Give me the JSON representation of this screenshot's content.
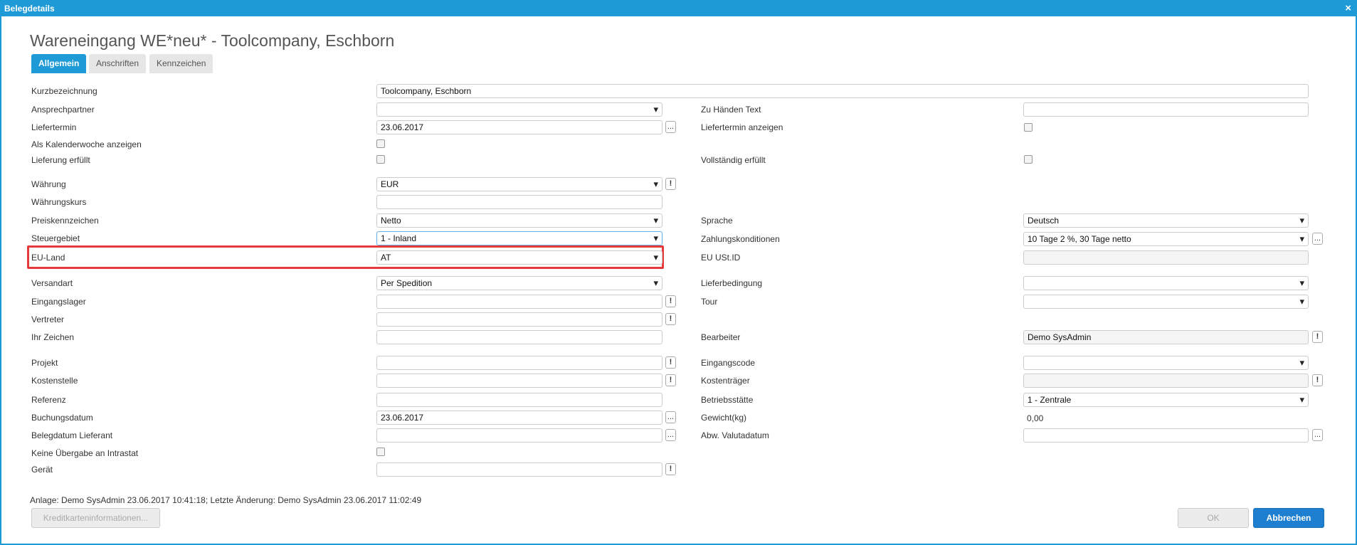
{
  "window": {
    "title": "Belegdetails",
    "close_glyph": "×"
  },
  "heading": "Wareneingang WE*neu* - Toolcompany, Eschborn",
  "tabs": [
    {
      "label": "Allgemein",
      "active": true
    },
    {
      "label": "Anschriften",
      "active": false
    },
    {
      "label": "Kennzeichen",
      "active": false
    }
  ],
  "left": {
    "kurzbezeichnung": {
      "label": "Kurzbezeichnung",
      "value": "Toolcompany, Eschborn"
    },
    "ansprechpartner": {
      "label": "Ansprechpartner",
      "value": ""
    },
    "liefertermin": {
      "label": "Liefertermin",
      "value": "23.06.2017"
    },
    "kalenderwoche": {
      "label": "Als Kalenderwoche anzeigen"
    },
    "lieferung_erfuellt": {
      "label": "Lieferung erfüllt"
    },
    "waehrung": {
      "label": "Währung",
      "value": "EUR"
    },
    "waehrungskurs": {
      "label": "Währungskurs",
      "value": ""
    },
    "preiskennzeichen": {
      "label": "Preiskennzeichen",
      "value": "Netto"
    },
    "steuergebiet": {
      "label": "Steuergebiet",
      "value": "1 - Inland"
    },
    "eu_land": {
      "label": "EU-Land",
      "value": "AT"
    },
    "versandart": {
      "label": "Versandart",
      "value": "Per Spedition"
    },
    "eingangslager": {
      "label": "Eingangslager",
      "value": ""
    },
    "vertreter": {
      "label": "Vertreter",
      "value": ""
    },
    "ihr_zeichen": {
      "label": "Ihr Zeichen",
      "value": ""
    },
    "projekt": {
      "label": "Projekt",
      "value": ""
    },
    "kostenstelle": {
      "label": "Kostenstelle",
      "value": ""
    },
    "referenz": {
      "label": "Referenz",
      "value": ""
    },
    "buchungsdatum": {
      "label": "Buchungsdatum",
      "value": "23.06.2017"
    },
    "belegdatum_lieferant": {
      "label": "Belegdatum Lieferant",
      "value": ""
    },
    "intrastat": {
      "label": "Keine Übergabe an Intrastat"
    },
    "geraet": {
      "label": "Gerät",
      "value": ""
    }
  },
  "right": {
    "zu_haenden": {
      "label": "Zu Händen Text",
      "value": ""
    },
    "liefertermin_anzeigen": {
      "label": "Liefertermin anzeigen"
    },
    "vollstaendig_erfuellt": {
      "label": "Vollständig erfüllt"
    },
    "sprache": {
      "label": "Sprache",
      "value": "Deutsch"
    },
    "zahlungskonditionen": {
      "label": "Zahlungskonditionen",
      "value": "10 Tage 2 %, 30 Tage netto"
    },
    "eu_ustid": {
      "label": "EU USt.ID",
      "value": ""
    },
    "lieferbedingung": {
      "label": "Lieferbedingung",
      "value": ""
    },
    "tour": {
      "label": "Tour",
      "value": ""
    },
    "bearbeiter": {
      "label": "Bearbeiter",
      "value": "Demo SysAdmin"
    },
    "eingangscode": {
      "label": "Eingangscode",
      "value": ""
    },
    "kostentraeger": {
      "label": "Kostenträger",
      "value": ""
    },
    "betriebsstaette": {
      "label": "Betriebsstätte",
      "value": "1 - Zentrale"
    },
    "gewicht": {
      "label": "Gewicht(kg)",
      "value": "0,00"
    },
    "valutadatum": {
      "label": "Abw. Valutadatum",
      "value": ""
    }
  },
  "small_buttons": {
    "dots": "...",
    "excl": "!"
  },
  "footer": {
    "info": "Anlage: Demo SysAdmin 23.06.2017 10:41:18; Letzte Änderung: Demo SysAdmin 23.06.2017 11:02:49",
    "kreditkarten": "Kreditkarteninformationen...",
    "ok": "OK",
    "abbrechen": "Abbrechen"
  }
}
